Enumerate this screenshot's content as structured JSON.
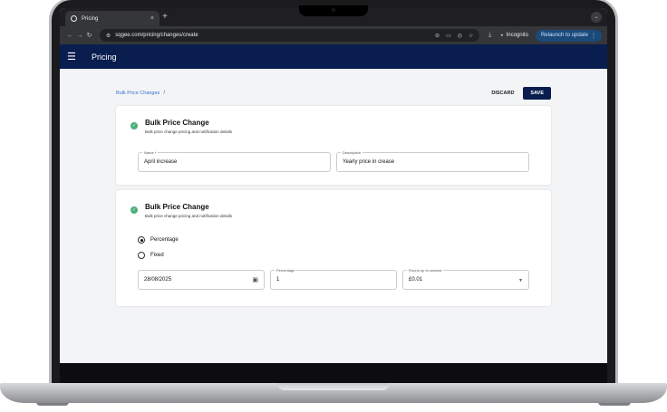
{
  "browser": {
    "tab_title": "Pricing",
    "tab_close": "×",
    "new_tab": "+",
    "url": "sqgee.com/pricing/changes/create",
    "incognito_label": "Incognito",
    "relaunch_label": "Relaunch to update"
  },
  "app": {
    "title": "Pricing"
  },
  "breadcrumb": {
    "label": "Bulk Price Changes",
    "separator": "/"
  },
  "actions": {
    "discard": "DISCARD",
    "save": "SAVE"
  },
  "card1": {
    "title": "Bulk Price Change",
    "subtitle": "Bulk price change pricing and notification details",
    "name_label": "Name *",
    "name_value": "April increase",
    "description_label": "Description",
    "description_value": "Yearly price in crease"
  },
  "card2": {
    "title": "Bulk Price Change",
    "subtitle": "Bulk price change pricing and notification details",
    "radio_percentage": "Percentage",
    "radio_fixed": "Fixed",
    "selected": "Percentage",
    "date_value": "28/08/2025",
    "percentage_label": "Percentage",
    "percentage_value": "1",
    "round_label": "Round up to nearest",
    "round_value": "£0.01"
  },
  "colors": {
    "appbar": "#0a1d4f",
    "link": "#3b6fd4",
    "success": "#4caf7a"
  }
}
